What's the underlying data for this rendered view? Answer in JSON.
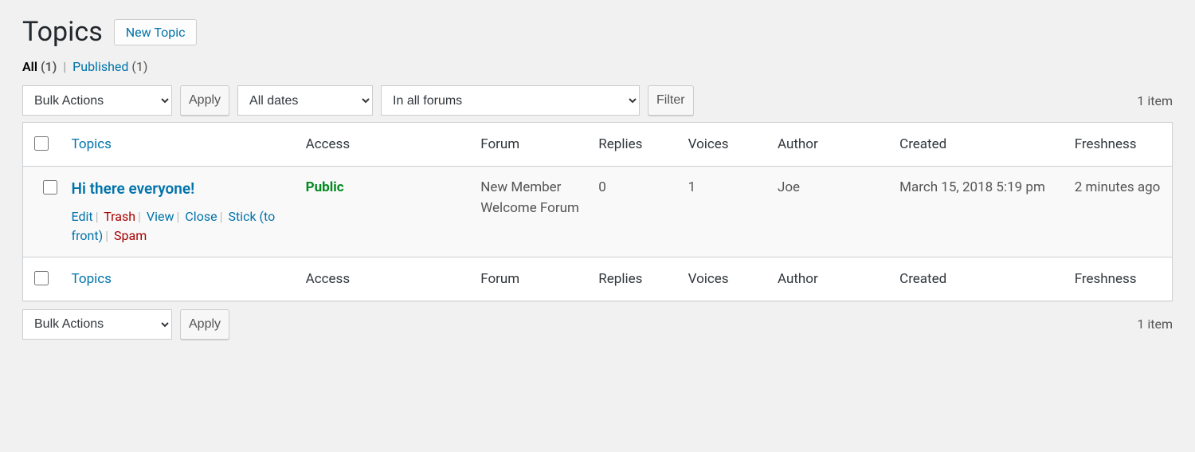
{
  "header": {
    "title": "Topics",
    "new_button": "New Topic"
  },
  "filters": {
    "all_label": "All",
    "all_count": "(1)",
    "published_label": "Published",
    "published_count": "(1)"
  },
  "top_controls": {
    "bulk_action": "Bulk Actions",
    "apply": "Apply",
    "date_filter": "All dates",
    "forum_filter": "In all forums",
    "filter": "Filter"
  },
  "pagination": {
    "item_count": "1 item"
  },
  "columns": {
    "topics": "Topics",
    "access": "Access",
    "forum": "Forum",
    "replies": "Replies",
    "voices": "Voices",
    "author": "Author",
    "created": "Created",
    "freshness": "Freshness"
  },
  "rows": [
    {
      "title": "Hi there everyone!",
      "actions": {
        "edit": "Edit",
        "trash": "Trash",
        "view": "View",
        "close": "Close",
        "stick": "Stick (to front)",
        "spam": "Spam"
      },
      "access": "Public",
      "forum": "New Member Welcome Forum",
      "replies": "0",
      "voices": "1",
      "author": "Joe",
      "created": "March 15, 2018 5:19 pm",
      "freshness": "2 minutes ago"
    }
  ],
  "bottom_controls": {
    "bulk_action": "Bulk Actions",
    "apply": "Apply",
    "item_count": "1 item"
  }
}
